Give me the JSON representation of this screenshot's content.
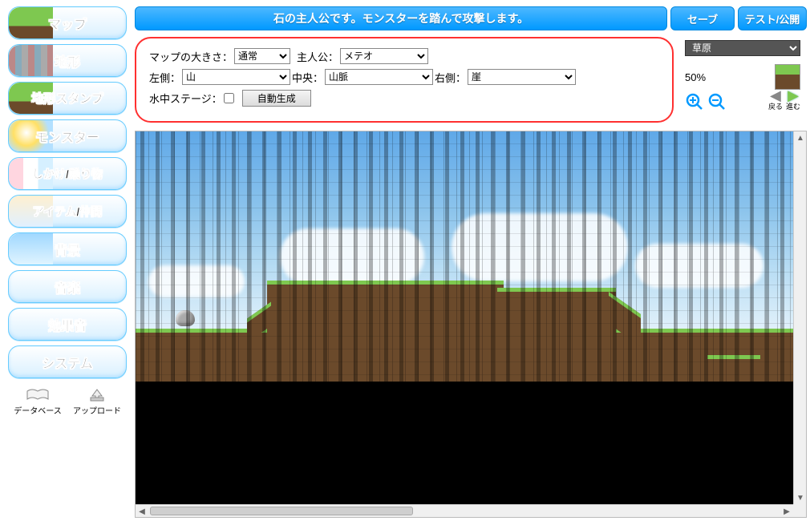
{
  "sidebar": {
    "items": [
      {
        "label": "マップ",
        "name": "map-button"
      },
      {
        "label": "地形",
        "name": "terrain-button"
      },
      {
        "label": "地形スタンプ",
        "name": "terrain-stamp-button"
      },
      {
        "label": "モンスター",
        "name": "monster-button"
      },
      {
        "label": "しかけ/乗り物",
        "name": "trick-vehicle-button"
      },
      {
        "label": "アイテム/仲間",
        "name": "item-ally-button"
      },
      {
        "label": "背景",
        "name": "background-button"
      },
      {
        "label": "音楽",
        "name": "music-button"
      },
      {
        "label": "効果音",
        "name": "sfx-button"
      },
      {
        "label": "システム",
        "name": "system-button"
      }
    ],
    "database_label": "データベース",
    "upload_label": "アップロード"
  },
  "topbar": {
    "message": "石の主人公です。モンスターを踏んで攻撃します。",
    "save_label": "セーブ",
    "test_label": "テスト/公開"
  },
  "config": {
    "map_size_label": "マップの大きさ：",
    "map_size_value": "通常",
    "hero_label": "主人公：",
    "hero_value": "メテオ",
    "left_label": "左側：",
    "left_value": "山",
    "center_label": "中央：",
    "center_value": "山脈",
    "right_label": "右側：",
    "right_value": "崖",
    "underwater_label": "水中ステージ：",
    "autogen_label": "自動生成"
  },
  "tileset": {
    "select_value": "草原",
    "zoom_pct": "50%",
    "back_label": "戻る",
    "forward_label": "進む"
  }
}
